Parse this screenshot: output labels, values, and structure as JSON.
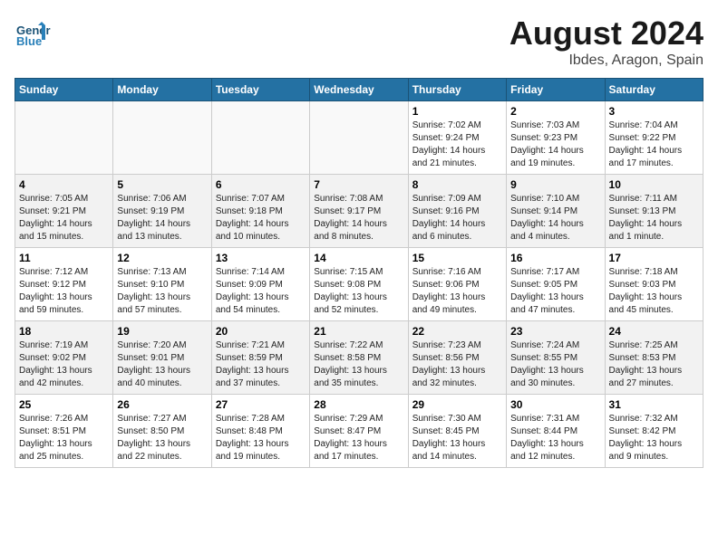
{
  "header": {
    "logo_general": "General",
    "logo_blue": "Blue",
    "month_year": "August 2024",
    "location": "Ibdes, Aragon, Spain"
  },
  "days_of_week": [
    "Sunday",
    "Monday",
    "Tuesday",
    "Wednesday",
    "Thursday",
    "Friday",
    "Saturday"
  ],
  "weeks": [
    [
      {
        "day": "",
        "info": ""
      },
      {
        "day": "",
        "info": ""
      },
      {
        "day": "",
        "info": ""
      },
      {
        "day": "",
        "info": ""
      },
      {
        "day": "1",
        "info": "Sunrise: 7:02 AM\nSunset: 9:24 PM\nDaylight: 14 hours\nand 21 minutes."
      },
      {
        "day": "2",
        "info": "Sunrise: 7:03 AM\nSunset: 9:23 PM\nDaylight: 14 hours\nand 19 minutes."
      },
      {
        "day": "3",
        "info": "Sunrise: 7:04 AM\nSunset: 9:22 PM\nDaylight: 14 hours\nand 17 minutes."
      }
    ],
    [
      {
        "day": "4",
        "info": "Sunrise: 7:05 AM\nSunset: 9:21 PM\nDaylight: 14 hours\nand 15 minutes."
      },
      {
        "day": "5",
        "info": "Sunrise: 7:06 AM\nSunset: 9:19 PM\nDaylight: 14 hours\nand 13 minutes."
      },
      {
        "day": "6",
        "info": "Sunrise: 7:07 AM\nSunset: 9:18 PM\nDaylight: 14 hours\nand 10 minutes."
      },
      {
        "day": "7",
        "info": "Sunrise: 7:08 AM\nSunset: 9:17 PM\nDaylight: 14 hours\nand 8 minutes."
      },
      {
        "day": "8",
        "info": "Sunrise: 7:09 AM\nSunset: 9:16 PM\nDaylight: 14 hours\nand 6 minutes."
      },
      {
        "day": "9",
        "info": "Sunrise: 7:10 AM\nSunset: 9:14 PM\nDaylight: 14 hours\nand 4 minutes."
      },
      {
        "day": "10",
        "info": "Sunrise: 7:11 AM\nSunset: 9:13 PM\nDaylight: 14 hours\nand 1 minute."
      }
    ],
    [
      {
        "day": "11",
        "info": "Sunrise: 7:12 AM\nSunset: 9:12 PM\nDaylight: 13 hours\nand 59 minutes."
      },
      {
        "day": "12",
        "info": "Sunrise: 7:13 AM\nSunset: 9:10 PM\nDaylight: 13 hours\nand 57 minutes."
      },
      {
        "day": "13",
        "info": "Sunrise: 7:14 AM\nSunset: 9:09 PM\nDaylight: 13 hours\nand 54 minutes."
      },
      {
        "day": "14",
        "info": "Sunrise: 7:15 AM\nSunset: 9:08 PM\nDaylight: 13 hours\nand 52 minutes."
      },
      {
        "day": "15",
        "info": "Sunrise: 7:16 AM\nSunset: 9:06 PM\nDaylight: 13 hours\nand 49 minutes."
      },
      {
        "day": "16",
        "info": "Sunrise: 7:17 AM\nSunset: 9:05 PM\nDaylight: 13 hours\nand 47 minutes."
      },
      {
        "day": "17",
        "info": "Sunrise: 7:18 AM\nSunset: 9:03 PM\nDaylight: 13 hours\nand 45 minutes."
      }
    ],
    [
      {
        "day": "18",
        "info": "Sunrise: 7:19 AM\nSunset: 9:02 PM\nDaylight: 13 hours\nand 42 minutes."
      },
      {
        "day": "19",
        "info": "Sunrise: 7:20 AM\nSunset: 9:01 PM\nDaylight: 13 hours\nand 40 minutes."
      },
      {
        "day": "20",
        "info": "Sunrise: 7:21 AM\nSunset: 8:59 PM\nDaylight: 13 hours\nand 37 minutes."
      },
      {
        "day": "21",
        "info": "Sunrise: 7:22 AM\nSunset: 8:58 PM\nDaylight: 13 hours\nand 35 minutes."
      },
      {
        "day": "22",
        "info": "Sunrise: 7:23 AM\nSunset: 8:56 PM\nDaylight: 13 hours\nand 32 minutes."
      },
      {
        "day": "23",
        "info": "Sunrise: 7:24 AM\nSunset: 8:55 PM\nDaylight: 13 hours\nand 30 minutes."
      },
      {
        "day": "24",
        "info": "Sunrise: 7:25 AM\nSunset: 8:53 PM\nDaylight: 13 hours\nand 27 minutes."
      }
    ],
    [
      {
        "day": "25",
        "info": "Sunrise: 7:26 AM\nSunset: 8:51 PM\nDaylight: 13 hours\nand 25 minutes."
      },
      {
        "day": "26",
        "info": "Sunrise: 7:27 AM\nSunset: 8:50 PM\nDaylight: 13 hours\nand 22 minutes."
      },
      {
        "day": "27",
        "info": "Sunrise: 7:28 AM\nSunset: 8:48 PM\nDaylight: 13 hours\nand 19 minutes."
      },
      {
        "day": "28",
        "info": "Sunrise: 7:29 AM\nSunset: 8:47 PM\nDaylight: 13 hours\nand 17 minutes."
      },
      {
        "day": "29",
        "info": "Sunrise: 7:30 AM\nSunset: 8:45 PM\nDaylight: 13 hours\nand 14 minutes."
      },
      {
        "day": "30",
        "info": "Sunrise: 7:31 AM\nSunset: 8:44 PM\nDaylight: 13 hours\nand 12 minutes."
      },
      {
        "day": "31",
        "info": "Sunrise: 7:32 AM\nSunset: 8:42 PM\nDaylight: 13 hours\nand 9 minutes."
      }
    ]
  ]
}
